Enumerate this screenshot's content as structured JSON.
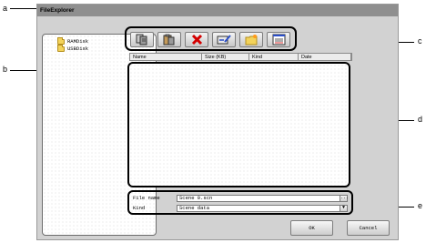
{
  "callouts": {
    "a": "a",
    "b": "b",
    "c": "c",
    "d": "d",
    "e": "e"
  },
  "window": {
    "title": "FileExplorer"
  },
  "tree": {
    "items": [
      {
        "label": "RAMDisk",
        "icon": "folder-icon"
      },
      {
        "label": "USBDisk",
        "icon": "folder-icon"
      }
    ]
  },
  "toolbar": {
    "buttons": [
      {
        "icon": "copy-icon"
      },
      {
        "icon": "paste-icon"
      },
      {
        "icon": "delete-icon"
      },
      {
        "icon": "rename-icon"
      },
      {
        "icon": "new-folder-icon"
      },
      {
        "icon": "details-icon"
      }
    ]
  },
  "file_list": {
    "columns": [
      "Name",
      "Size (KB)",
      "Kind",
      "Date"
    ],
    "rows": []
  },
  "properties": {
    "file_name_label": "File name",
    "file_name_value": "Scene 0.scn",
    "browse_label": "...",
    "kind_label": "Kind",
    "kind_value": "Scene data",
    "kind_dropdown_glyph": "▼"
  },
  "buttons": {
    "ok": "OK",
    "cancel": "Cancel"
  },
  "colors": {
    "titlebar": "#8f8f8f",
    "window_bg": "#d2d2d2",
    "folder": "#f3d35b",
    "delete_red": "#d40000"
  }
}
